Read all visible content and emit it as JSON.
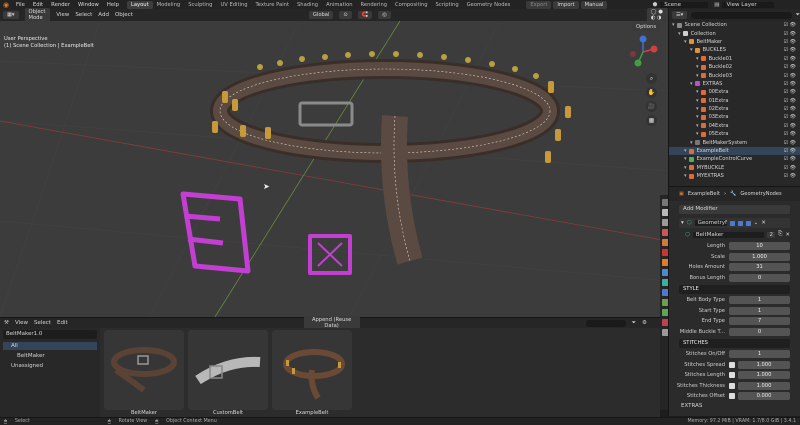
{
  "topbar": {
    "menus": [
      "File",
      "Edit",
      "Render",
      "Window",
      "Help"
    ],
    "workspaces": [
      "Layout",
      "Modeling",
      "Sculpting",
      "UV Editing",
      "Texture Paint",
      "Shading",
      "Animation",
      "Rendering",
      "Compositing",
      "Scripting",
      "Geometry Nodes"
    ],
    "active_workspace": "Layout",
    "export_label": "Export",
    "import_label": "Import",
    "manual_label": "Manual",
    "scene": "Scene",
    "view_layer": "View Layer"
  },
  "viewport": {
    "mode": "Object Mode",
    "menus": [
      "View",
      "Select",
      "Add",
      "Object"
    ],
    "orientation": "Global",
    "options_label": "Options",
    "info_line1": "User Perspective",
    "info_line2": "(1) Scene Collection | ExampleBelt"
  },
  "outliner": {
    "rows": [
      {
        "label": "Scene Collection",
        "indent": 0,
        "swatch": "#8a8a8a",
        "selected": false
      },
      {
        "label": "Collection",
        "indent": 1,
        "swatch": "#d0d0d0",
        "selected": false
      },
      {
        "label": "BeltMaker",
        "indent": 2,
        "swatch": "#e0913a",
        "selected": false
      },
      {
        "label": "BUCKLES",
        "indent": 3,
        "swatch": "#e0913a",
        "selected": false
      },
      {
        "label": "Buckle01",
        "indent": 4,
        "swatch": "#e06a3a",
        "selected": false
      },
      {
        "label": "Buckle02",
        "indent": 4,
        "swatch": "#e06a3a",
        "selected": false
      },
      {
        "label": "Buckle03",
        "indent": 4,
        "swatch": "#e06a3a",
        "selected": false
      },
      {
        "label": "EXTRAS",
        "indent": 3,
        "swatch": "#c050d0",
        "selected": false
      },
      {
        "label": "00Extra",
        "indent": 4,
        "swatch": "#e06a3a",
        "selected": false
      },
      {
        "label": "01Extra",
        "indent": 4,
        "swatch": "#e06a3a",
        "selected": false
      },
      {
        "label": "02Extra",
        "indent": 4,
        "swatch": "#e06a3a",
        "selected": false
      },
      {
        "label": "03Extra",
        "indent": 4,
        "swatch": "#e06a3a",
        "selected": false
      },
      {
        "label": "04Extra",
        "indent": 4,
        "swatch": "#e06a3a",
        "selected": false
      },
      {
        "label": "05Extra",
        "indent": 4,
        "swatch": "#e06a3a",
        "selected": false
      },
      {
        "label": "BeltMakerSystem",
        "indent": 3,
        "swatch": "#777777",
        "selected": false
      },
      {
        "label": "ExampleBelt",
        "indent": 2,
        "swatch": "#e06a3a",
        "selected": true
      },
      {
        "label": "ExampleControlCurve",
        "indent": 2,
        "swatch": "#50b060",
        "selected": false
      },
      {
        "label": "MYBUCKLE",
        "indent": 2,
        "swatch": "#e06a3a",
        "selected": false
      },
      {
        "label": "MYEXTRAS",
        "indent": 2,
        "swatch": "#e06a3a",
        "selected": false
      }
    ]
  },
  "properties": {
    "breadcrumb_object": "ExampleBelt",
    "breadcrumb_modifier": "GeometryNodes",
    "add_modifier_label": "Add Modifier",
    "modifier_name": "GeometryNo...",
    "node_group": "BeltMaker",
    "node_group_users": "2",
    "fields": [
      {
        "label": "Length",
        "value": "10"
      },
      {
        "label": "Scale",
        "value": "1.000"
      },
      {
        "label": "Holes Amount",
        "value": "31"
      },
      {
        "label": "Bonus Length",
        "value": "0"
      }
    ],
    "style_header": "STYLE",
    "style_fields": [
      {
        "label": "Belt Body Type",
        "value": "1"
      },
      {
        "label": "Start Type",
        "value": "1"
      },
      {
        "label": "End Type",
        "value": "7"
      },
      {
        "label": "Middle Buckle T...",
        "value": "0"
      }
    ],
    "stitches_header": "STITCHES",
    "stitch_fields": [
      {
        "label": "Stitches On/Off",
        "value": "1"
      },
      {
        "label": "Stitches Spread",
        "value": "1.000"
      },
      {
        "label": "Stitches Length",
        "value": "1.000"
      },
      {
        "label": "Stitches Thickness",
        "value": "1.000"
      },
      {
        "label": "Stitches Offset",
        "value": "0.000"
      }
    ],
    "extras_header": "EXTRAS"
  },
  "asset_browser": {
    "menus": [
      "View",
      "Select",
      "Edit"
    ],
    "import_mode": "Append (Reuse Data)",
    "library": "BeltMaker1.0",
    "catalog_all": "All",
    "catalog_beltmaker": "BeltMaker",
    "catalog_unassigned": "Unassigned",
    "assets": [
      "BeltMaker",
      "CustomBelt",
      "ExampleBelt"
    ]
  },
  "statusbar": {
    "select": "Select",
    "rotate": "Rotate View",
    "context": "Object Context Menu",
    "memory": "Memory: 97.2 MiB | VRAM: 1.7/8.0 GiB | 3.4.1"
  },
  "colors": {
    "accent": "#e07b28",
    "selection": "#34455a",
    "viewport_bg": "#3c3c3c",
    "magenta": "#c23fd2"
  }
}
